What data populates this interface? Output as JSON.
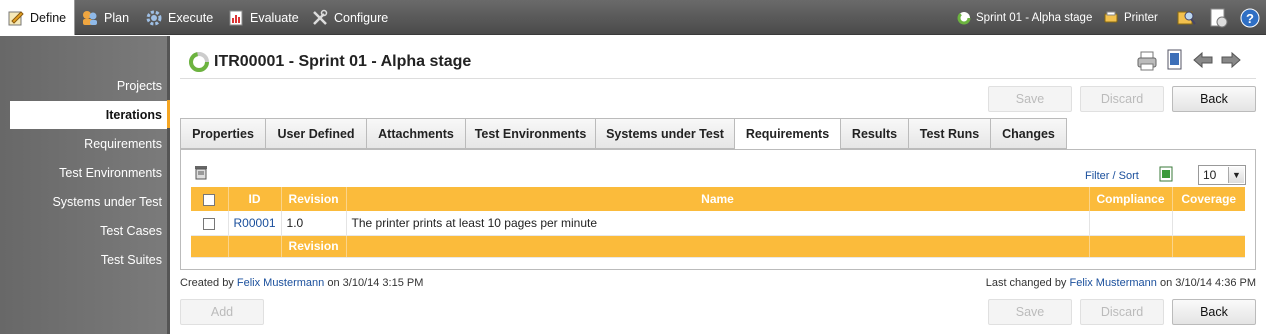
{
  "topnav": {
    "items": [
      {
        "label": "Define",
        "icon": "define-icon"
      },
      {
        "label": "Plan",
        "icon": "plan-icon"
      },
      {
        "label": "Execute",
        "icon": "execute-gear-icon"
      },
      {
        "label": "Evaluate",
        "icon": "evaluate-icon"
      },
      {
        "label": "Configure",
        "icon": "configure-tools-icon"
      }
    ],
    "iteration_label": "Sprint 01 - Alpha stage",
    "printer_label": "Printer"
  },
  "sidebar": {
    "items": [
      {
        "label": "Projects"
      },
      {
        "label": "Iterations"
      },
      {
        "label": "Requirements"
      },
      {
        "label": "Test Environments"
      },
      {
        "label": "Systems under Test"
      },
      {
        "label": "Test Cases"
      },
      {
        "label": "Test Suites"
      }
    ]
  },
  "header": {
    "title": "ITR00001 - Sprint 01 - Alpha stage"
  },
  "actions": {
    "save": "Save",
    "discard": "Discard",
    "back": "Back",
    "add": "Add"
  },
  "tabs": [
    {
      "label": "Properties"
    },
    {
      "label": "User Defined"
    },
    {
      "label": "Attachments"
    },
    {
      "label": "Test Environments"
    },
    {
      "label": "Systems under Test"
    },
    {
      "label": "Requirements"
    },
    {
      "label": "Results"
    },
    {
      "label": "Test Runs"
    },
    {
      "label": "Changes"
    }
  ],
  "grid": {
    "filter_sort_label": "Filter / Sort",
    "page_size": "10",
    "columns": [
      "ID",
      "Revision",
      "Name",
      "Compliance",
      "Coverage"
    ],
    "rows": [
      {
        "id": "R00001",
        "revision": "1.0",
        "name": "The printer prints at least 10 pages per minute",
        "compliance": "",
        "coverage": ""
      }
    ],
    "footer_revision": "Revision"
  },
  "meta": {
    "created_prefix": "Created by",
    "created_by": "Felix Mustermann",
    "created_on": "on 3/10/14 3:15 PM",
    "changed_prefix": "Last changed by",
    "changed_by": "Felix Mustermann",
    "changed_on": "on 3/10/14 4:36 PM"
  },
  "colors": {
    "accent_orange": "#fbbb3b",
    "link_blue": "#1a4f9c",
    "topbar_gray": "#5a5a5a"
  }
}
